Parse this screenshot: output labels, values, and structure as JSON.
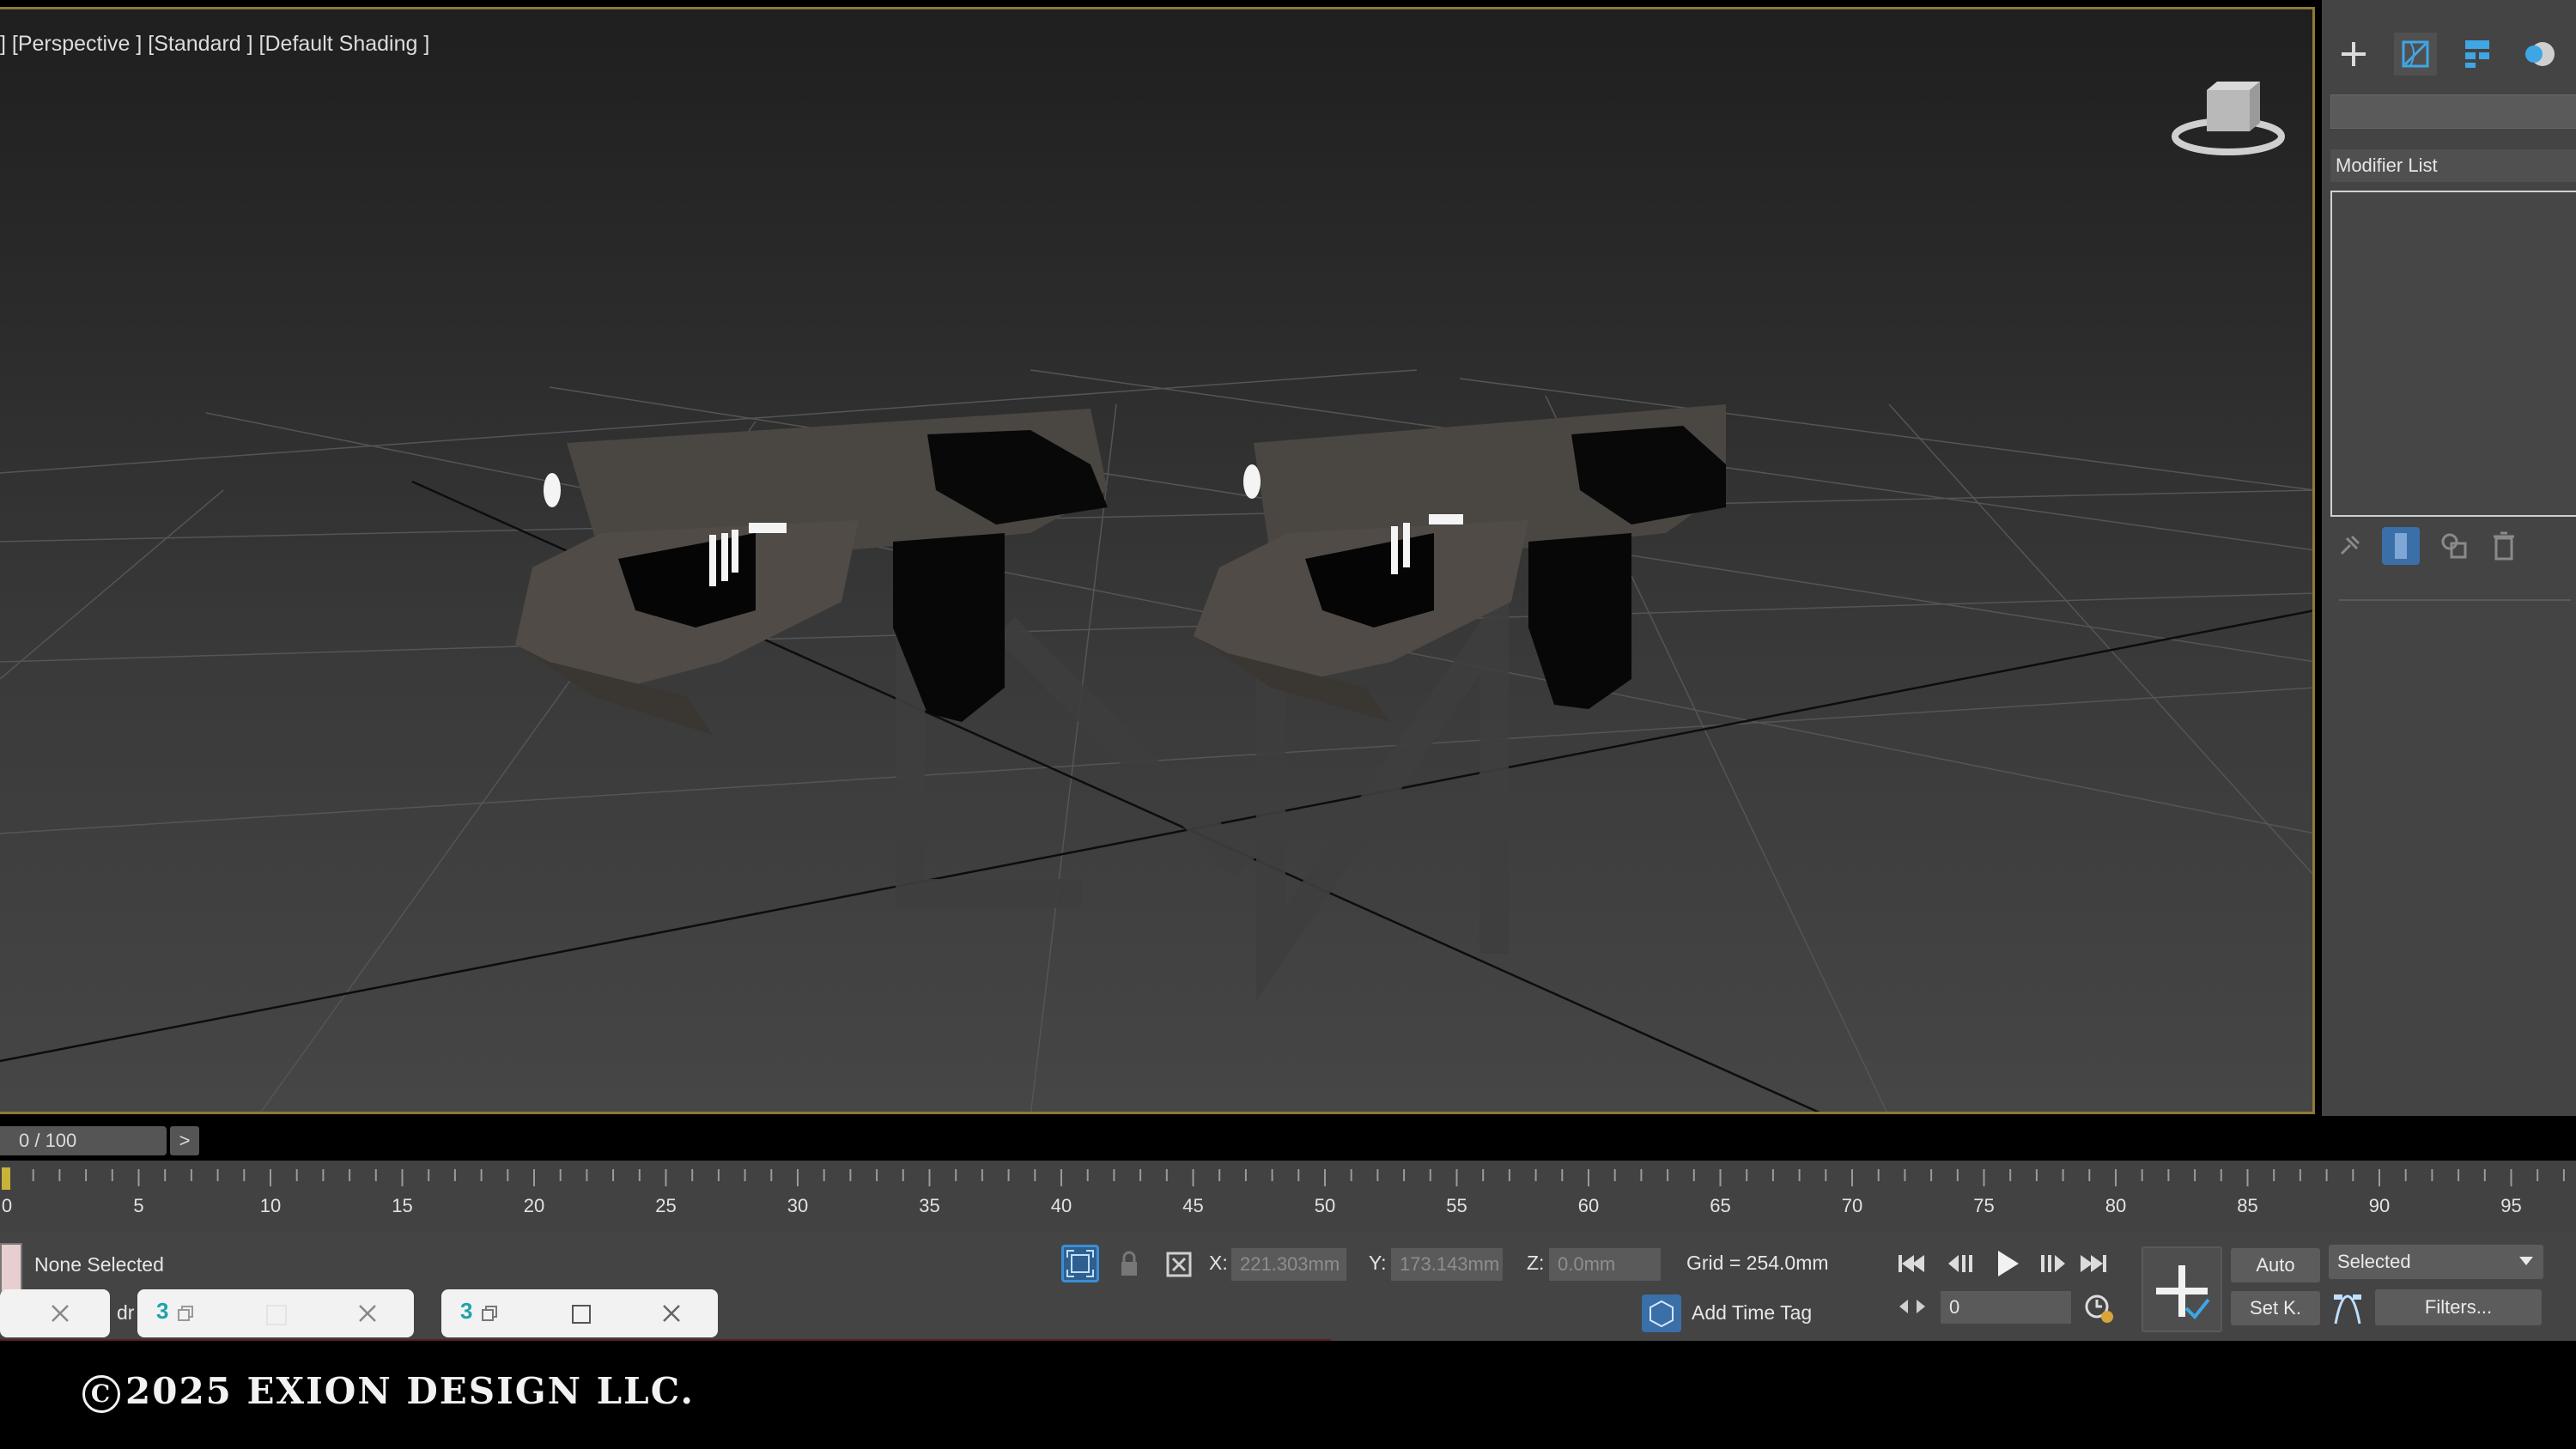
{
  "viewport": {
    "label": "] [Perspective ] [Standard ] [Default Shading ]",
    "viewcube_face": "front"
  },
  "command_panel": {
    "tabs": [
      "create-icon",
      "modify-icon",
      "hierarchy-icon",
      "motion-icon"
    ],
    "modifier_list_label": "Modifier List",
    "tools": [
      "pin-stack-icon",
      "show-end-result-icon",
      "make-unique-icon",
      "remove-modifier-icon"
    ]
  },
  "timeline": {
    "frame_counter": "0 / 100",
    "next_label": ">",
    "ticks": [
      "0",
      "5",
      "10",
      "15",
      "20",
      "25",
      "30",
      "35",
      "40",
      "45",
      "50",
      "55",
      "60",
      "65",
      "70",
      "75",
      "80",
      "85",
      "90",
      "95"
    ]
  },
  "status": {
    "selection_text": "None Selected",
    "partial_text": "dr",
    "x_label": "X:",
    "x_value": "221.303mm",
    "y_label": "Y:",
    "y_value": "173.143mm",
    "z_label": "Z:",
    "z_value": "0.0mm",
    "grid_text": "Grid = 254.0mm",
    "add_time_tag": "Add Time Tag",
    "frame_value": "0",
    "auto_label": "Auto",
    "setkey_label": "Set K.",
    "selected_dropdown": "Selected",
    "filters_label": "Filters..."
  },
  "footer": {
    "copyright": "2025 EXION DESIGN LLC."
  },
  "colors": {
    "viewport_border": "#8f7a34",
    "panel_bg": "#444444",
    "accent_blue": "#3b8fd6"
  }
}
